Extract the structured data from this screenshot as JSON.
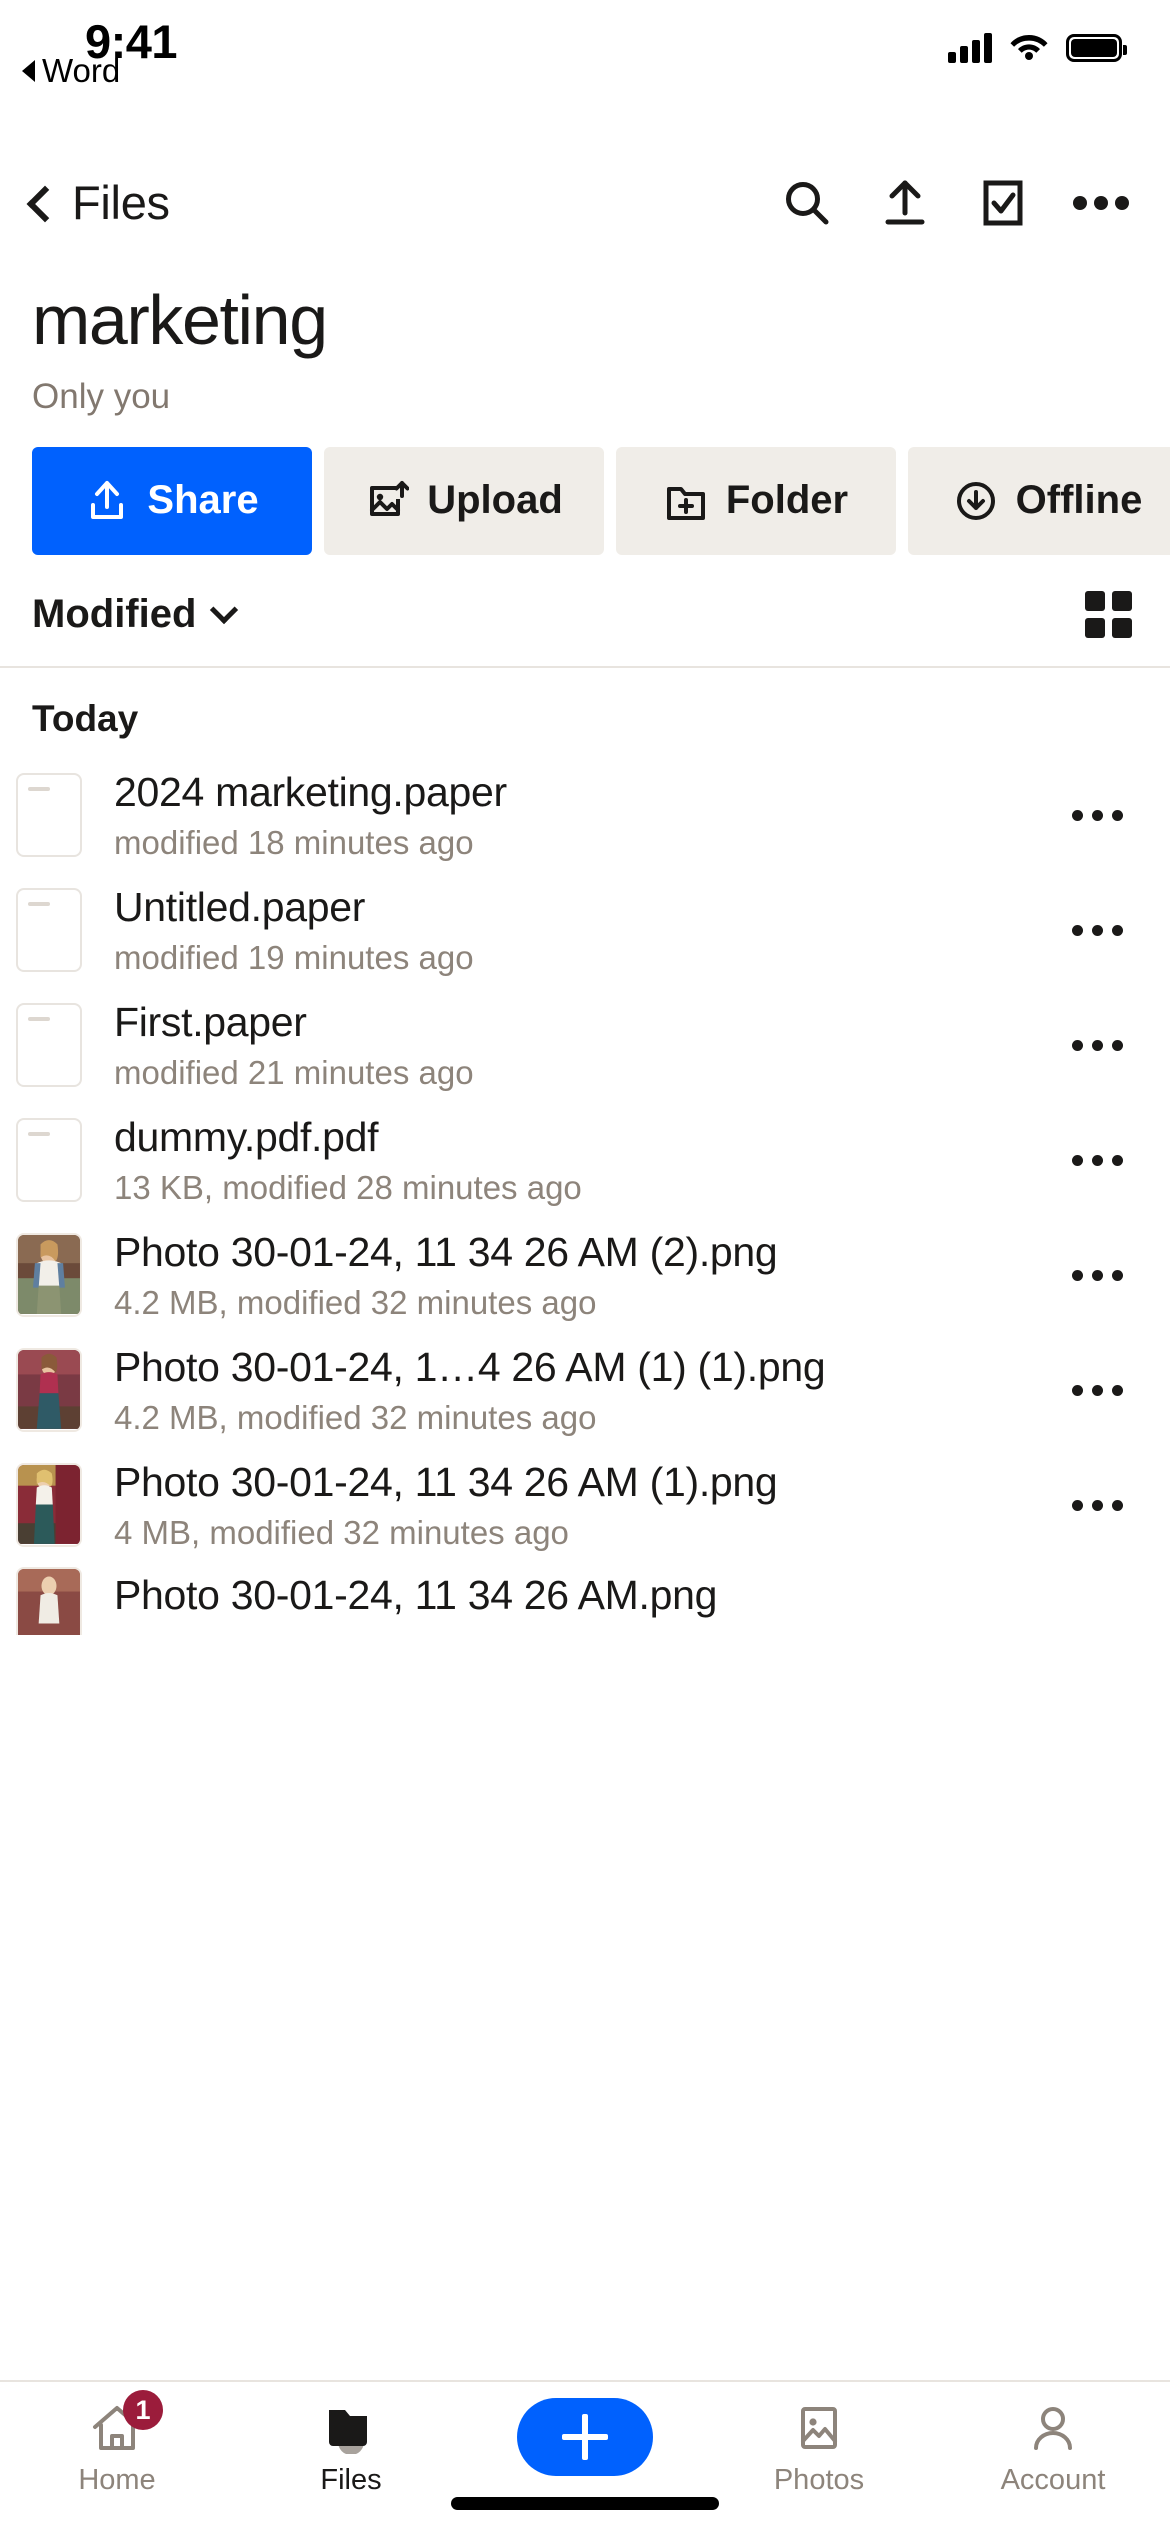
{
  "status_bar": {
    "time": "9:41",
    "back_to_app": "Word",
    "signal_icon": "cellular-bars-icon",
    "wifi_icon": "wifi-icon",
    "battery_icon": "battery-full-icon"
  },
  "nav": {
    "back_label": "Files",
    "back_icon": "chevron-left-icon",
    "actions": [
      {
        "name": "search-icon",
        "label": "Search"
      },
      {
        "name": "upload-icon",
        "label": "Upload"
      },
      {
        "name": "select-checkbox-icon",
        "label": "Select"
      },
      {
        "name": "more-horizontal-icon",
        "label": "More"
      }
    ]
  },
  "header": {
    "title": "marketing",
    "subtitle": "Only you"
  },
  "chips": [
    {
      "label": "Share",
      "icon": "share-up-icon",
      "primary": true
    },
    {
      "label": "Upload",
      "icon": "photo-upload-icon",
      "primary": false
    },
    {
      "label": "Folder",
      "icon": "folder-plus-icon",
      "primary": false
    },
    {
      "label": "Offline",
      "icon": "cloud-download-icon",
      "primary": false
    }
  ],
  "sort": {
    "label": "Modified",
    "chevron_icon": "chevron-down-icon",
    "view_toggle_icon": "grid-view-icon"
  },
  "list": {
    "section_header": "Today",
    "items": [
      {
        "name": "2024 marketing.paper",
        "meta": "modified 18 minutes ago",
        "kind": "doc"
      },
      {
        "name": "Untitled.paper",
        "meta": "modified 19 minutes ago",
        "kind": "doc"
      },
      {
        "name": "First.paper",
        "meta": "modified 21 minutes ago",
        "kind": "doc"
      },
      {
        "name": "dummy.pdf.pdf",
        "meta": "13 KB, modified 28 minutes ago",
        "kind": "doc"
      },
      {
        "name": "Photo 30-01-24, 11 34 26 AM (2).png",
        "meta": "4.2 MB, modified 32 minutes ago",
        "kind": "photo"
      },
      {
        "name": "Photo 30-01-24, 1…4 26 AM (1) (1).png",
        "meta": "4.2 MB, modified 32 minutes ago",
        "kind": "photo"
      },
      {
        "name": "Photo 30-01-24, 11 34 26 AM (1).png",
        "meta": "4 MB, modified 32 minutes ago",
        "kind": "photo"
      },
      {
        "name": "Photo 30-01-24, 11 34 26 AM.png",
        "meta": "",
        "kind": "photo"
      }
    ],
    "row_more_icon": "more-horizontal-icon"
  },
  "tabbar": {
    "tabs": [
      {
        "label": "Home",
        "icon": "home-icon",
        "active": false,
        "badge": "1"
      },
      {
        "label": "Files",
        "icon": "folder-filled-icon",
        "active": true,
        "badge": ""
      },
      {
        "label": "",
        "icon": "plus-icon",
        "active": false,
        "badge": ""
      },
      {
        "label": "Photos",
        "icon": "photos-icon",
        "active": false,
        "badge": ""
      },
      {
        "label": "Account",
        "icon": "person-icon",
        "active": false,
        "badge": ""
      }
    ]
  },
  "colors": {
    "brand_blue": "#0061FE",
    "chip_bg": "#F0EDE8",
    "text_primary": "#1A1918",
    "text_secondary": "#8D847B",
    "badge_red": "#9B1C3B"
  }
}
